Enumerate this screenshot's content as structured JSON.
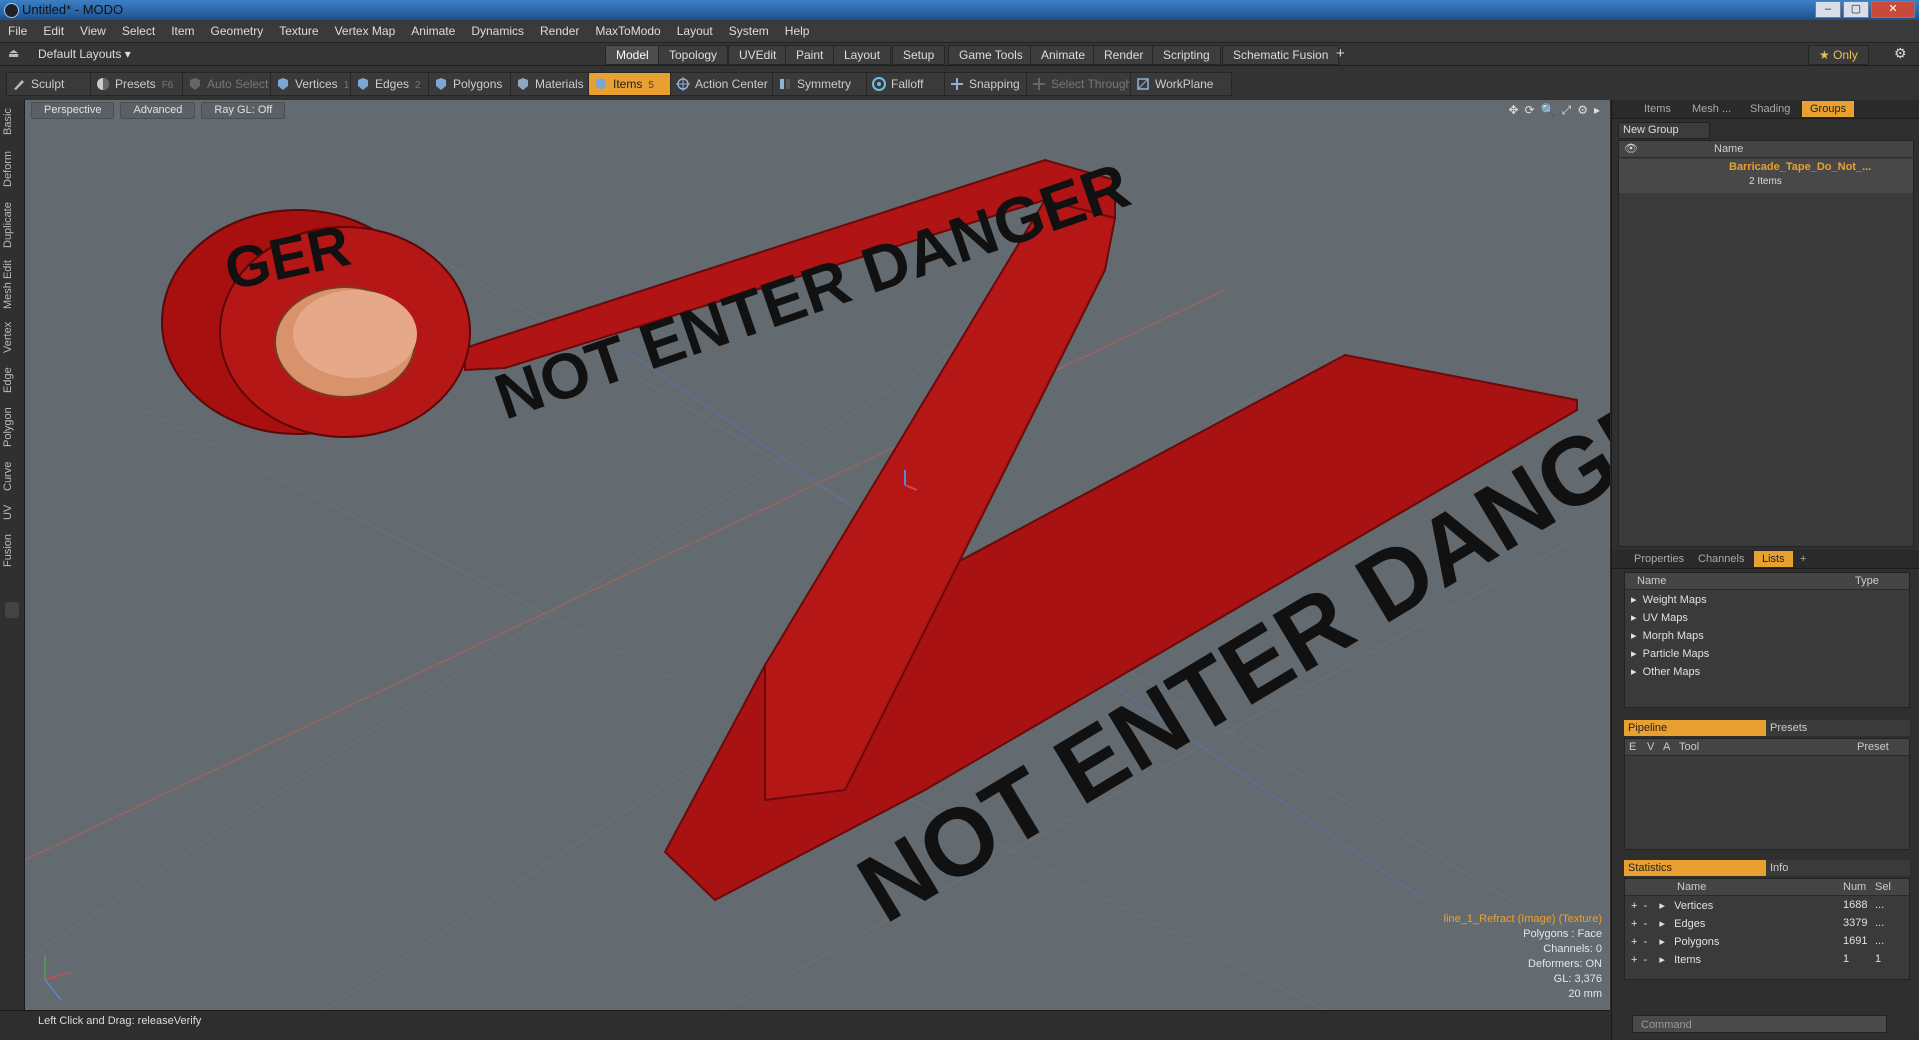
{
  "window": {
    "title": "Untitled* - MODO",
    "min": "–",
    "max": "▢",
    "close": "✕"
  },
  "menu": [
    "File",
    "Edit",
    "View",
    "Select",
    "Item",
    "Geometry",
    "Texture",
    "Vertex Map",
    "Animate",
    "Dynamics",
    "Render",
    "MaxToModo",
    "Layout",
    "System",
    "Help"
  ],
  "layouts": {
    "dropdown": "Default Layouts ▾",
    "tabs": [
      "Model",
      "Topology",
      "UVEdit",
      "Paint",
      "Layout",
      "Setup",
      "Game Tools",
      "Animate",
      "Render",
      "Scripting",
      "Schematic Fusion"
    ],
    "add": "+",
    "only": "★  Only",
    "gear": "⚙"
  },
  "toolbar": {
    "sculpt": "Sculpt",
    "presets": "Presets",
    "presets_key": "F6",
    "auto_select": "Auto Select",
    "vertices": "Vertices",
    "vertices_key": "1",
    "edges": "Edges",
    "edges_key": "2",
    "polygons": "Polygons",
    "materials": "Materials",
    "items": "Items",
    "items_key": "5",
    "action_center": "Action Center",
    "symmetry": "Symmetry",
    "falloff": "Falloff",
    "snapping": "Snapping",
    "select_through": "Select Through",
    "workplane": "WorkPlane"
  },
  "left_tabs": [
    "Basic",
    "Deform",
    "Duplicate",
    "Mesh Edit",
    "Vertex",
    "Edge",
    "Polygon",
    "Curve",
    "UV",
    "Fusion"
  ],
  "viewport": {
    "view": "Perspective",
    "advanced": "Advanced",
    "raygl": "Ray GL: Off",
    "icons": [
      "✥",
      "⟳",
      "🔍",
      "⤢",
      "⚙",
      "▸"
    ],
    "tape_text_1": "NOT ENTER DANGER",
    "tape_text_2": "NOT ENTER DANGER",
    "roll_text": "GER",
    "info": {
      "texture": "line_1_Refract (Image) (Texture)",
      "polygons": "Polygons : Face",
      "channels": "Channels: 0",
      "deformers": "Deformers: ON",
      "gl": "GL: 3,376",
      "scale": "20 mm"
    }
  },
  "status": {
    "text": "Left Click and Drag:   releaseVerify"
  },
  "right_panel": {
    "top_tabs": [
      "Items",
      "Mesh ...",
      "Shading",
      "Groups"
    ],
    "new_group": "New Group",
    "groups_header": "Name",
    "group_name": "Barricade_Tape_Do_Not_...",
    "group_count": "2 Items",
    "mid_tabs": [
      "Properties",
      "Channels",
      "Lists",
      "+"
    ],
    "lists_header": {
      "name": "Name",
      "type": "Type"
    },
    "lists": [
      "Weight Maps",
      "UV Maps",
      "Morph Maps",
      "Particle Maps",
      "Other Maps"
    ],
    "pipeline_tabs": [
      "Pipeline",
      "Presets"
    ],
    "pipeline_header": {
      "e": "E",
      "v": "V",
      "a": "A",
      "tool": "Tool",
      "preset": "Preset"
    },
    "stats_tabs": [
      "Statistics",
      "Info"
    ],
    "stats_header": {
      "name": "Name",
      "num": "Num",
      "sel": "Sel"
    },
    "stats": [
      {
        "name": "Vertices",
        "num": "1688",
        "sel": "..."
      },
      {
        "name": "Edges",
        "num": "3379",
        "sel": "..."
      },
      {
        "name": "Polygons",
        "num": "1691",
        "sel": "..."
      },
      {
        "name": "Items",
        "num": "1",
        "sel": "1"
      }
    ],
    "command_placeholder": "Command"
  },
  "colors": {
    "accent": "#e8a131",
    "tape": "#b01414",
    "viewport_bg": "#646b70"
  }
}
